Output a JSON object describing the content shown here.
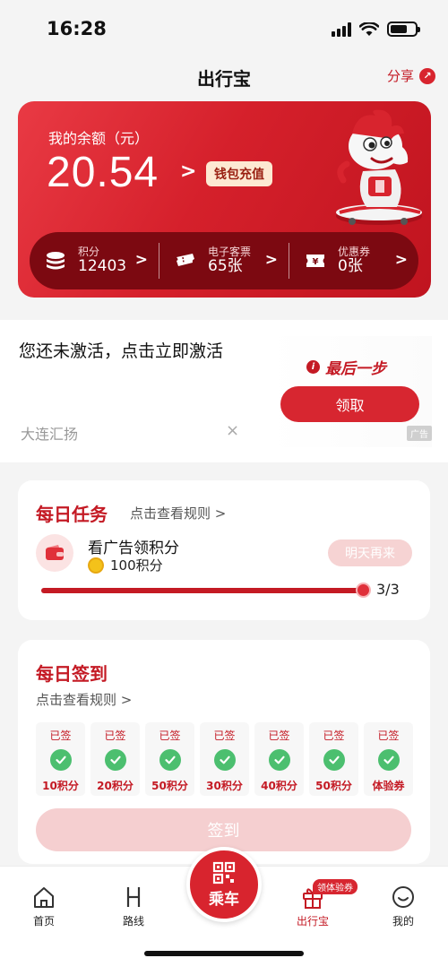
{
  "status_bar": {
    "time": "16:28"
  },
  "header": {
    "title": "出行宝",
    "share_label": "分享"
  },
  "wallet": {
    "balance_label": "我的余额（元）",
    "balance": "20.54",
    "arrow": ">",
    "recharge_label": "钱包充值",
    "items": [
      {
        "label": "积分",
        "value": "12403",
        "icon": "coins-icon"
      },
      {
        "label": "电子客票",
        "value": "65张",
        "icon": "ticket-icon"
      },
      {
        "label": "优惠券",
        "value": "0张",
        "icon": "coupon-icon"
      }
    ],
    "item_arrow": ">"
  },
  "ad": {
    "title": "您还未激活，点击立即激活",
    "source": "大连汇扬",
    "close": "×",
    "highlight": "最后一步",
    "button": "领取",
    "tag": "广告"
  },
  "daily_task": {
    "title": "每日任务",
    "rule_link": "点击查看规则 >",
    "task_name": "看广告领积分",
    "reward": "100积分",
    "button": "明天再来",
    "progress_text": "3/3",
    "progress": 1.0
  },
  "daily_signin": {
    "title": "每日签到",
    "rule_link": "点击查看规则 >",
    "days": [
      {
        "status": "已签",
        "reward": "10积分"
      },
      {
        "status": "已签",
        "reward": "20积分"
      },
      {
        "status": "已签",
        "reward": "50积分"
      },
      {
        "status": "已签",
        "reward": "30积分"
      },
      {
        "status": "已签",
        "reward": "40积分"
      },
      {
        "status": "已签",
        "reward": "50积分"
      },
      {
        "status": "已签",
        "reward": "体验券"
      }
    ],
    "button": "签到"
  },
  "tabbar": {
    "items": [
      {
        "label": "首页",
        "icon": "home-icon"
      },
      {
        "label": "路线",
        "icon": "route-icon"
      },
      {
        "label": "乘车",
        "icon": "qr-code-icon"
      },
      {
        "label": "出行宝",
        "icon": "gift-icon",
        "badge": "领体验券"
      },
      {
        "label": "我的",
        "icon": "profile-icon"
      }
    ]
  },
  "colors": {
    "brand": "#d8242e",
    "dark_red": "#7c0911",
    "success": "#4cbf6f"
  }
}
